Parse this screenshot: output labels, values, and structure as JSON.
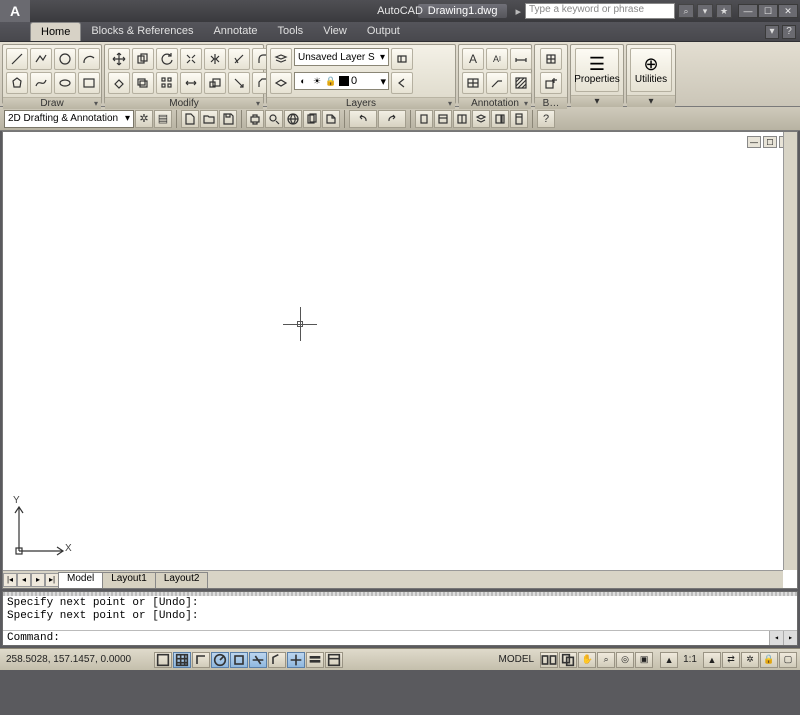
{
  "app_title": "AutoCAD",
  "doc_title": "Drawing1.dwg",
  "title_arrow": "▸",
  "search_placeholder": "Type a keyword or phrase",
  "menu": {
    "tabs": [
      "Home",
      "Blocks & References",
      "Annotate",
      "Tools",
      "View",
      "Output"
    ],
    "active": "Home",
    "tail_icon": "▾"
  },
  "ribbon": {
    "panels": {
      "draw": {
        "title": "Draw"
      },
      "modify": {
        "title": "Modify"
      },
      "layers": {
        "title": "Layers",
        "combo": "Unsaved Layer S",
        "current_layer": "0"
      },
      "annotation": {
        "title": "Annotation"
      },
      "block": {
        "title": "B…"
      },
      "properties": {
        "title": "Properties"
      },
      "utilities": {
        "title": "Utilities"
      }
    }
  },
  "workspace": {
    "combo": "2D Drafting & Annotation"
  },
  "canvas": {
    "ucs": {
      "x": "X",
      "y": "Y"
    },
    "layout_tabs": [
      "Model",
      "Layout1",
      "Layout2"
    ]
  },
  "command": {
    "history": [
      "Specify next point or [Undo]:",
      "Specify next point or [Undo]:"
    ],
    "prompt": "Command:"
  },
  "status": {
    "coords": "258.5028, 157.1457, 0.0000",
    "model": "MODEL",
    "scale": "1:1",
    "anno": "▸"
  }
}
